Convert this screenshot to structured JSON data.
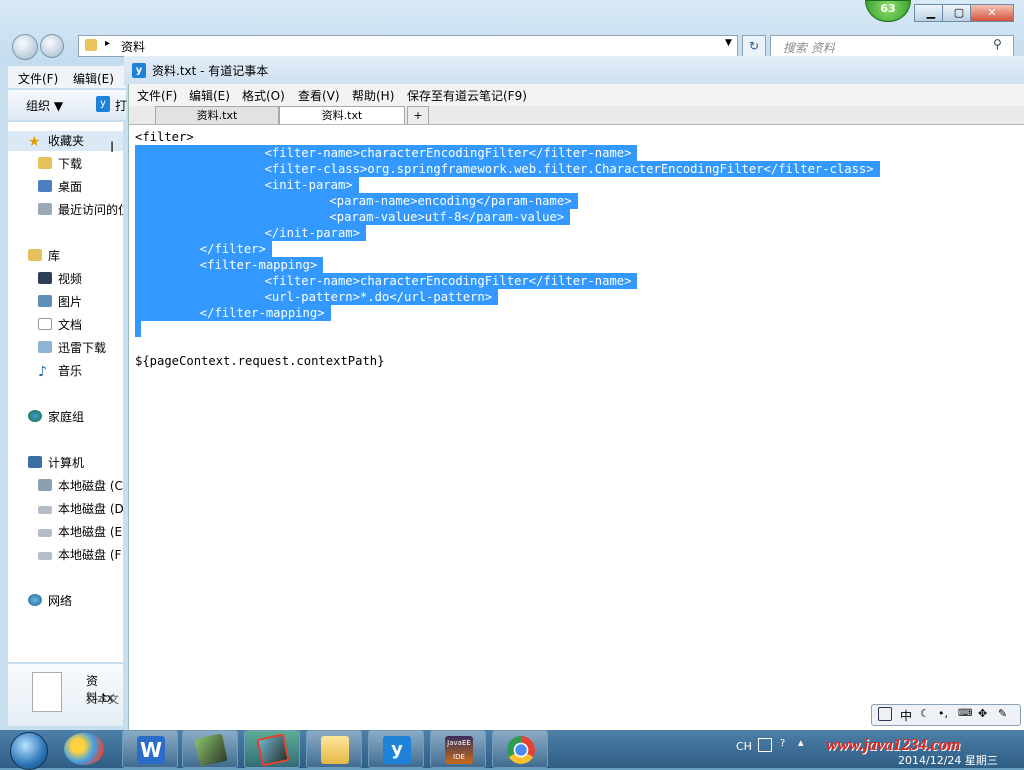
{
  "explorer": {
    "address": "资料",
    "search_placeholder": "搜索 资料",
    "menu": [
      "文件(F)",
      "编辑(E)"
    ],
    "toolbar": {
      "organize": "组织 ▼",
      "open_label": "打"
    },
    "badge": "63",
    "nav": {
      "favorites": "收藏夹",
      "download": "下载",
      "desktop": "桌面",
      "recent": "最近访问的位",
      "libraries": "库",
      "videos": "视频",
      "pictures": "图片",
      "documents": "文档",
      "xunlei": "迅雷下载",
      "music": "音乐",
      "homegroup": "家庭组",
      "computer": "计算机",
      "disk_c": "本地磁盘 (C",
      "disk_d": "本地磁盘 (D",
      "disk_e": "本地磁盘 (E",
      "disk_f": "本地磁盘 (F",
      "network": "网络"
    },
    "details": {
      "filename": "资料.tx",
      "filetype": "文本文"
    }
  },
  "notepad": {
    "title": "资料.txt - 有道记事本",
    "menu": [
      "文件(F)",
      "编辑(E)",
      "格式(O)",
      "查看(V)",
      "帮助(H)",
      "保存至有道云笔记(F9)"
    ],
    "tabs": [
      "资料.txt",
      "资料.txt"
    ],
    "add_tab": "+",
    "lines": [
      {
        "text": "<filter>",
        "indent": 0,
        "selected": false
      },
      {
        "text": "<filter-name>characterEncodingFilter</filter-name>",
        "indent": 2,
        "selected": true
      },
      {
        "text": "<filter-class>org.springframework.web.filter.CharacterEncodingFilter</filter-class>",
        "indent": 2,
        "selected": true
      },
      {
        "text": "<init-param>",
        "indent": 2,
        "selected": true
      },
      {
        "text": "<param-name>encoding</param-name>",
        "indent": 3,
        "selected": true
      },
      {
        "text": "<param-value>utf-8</param-value>",
        "indent": 3,
        "selected": true
      },
      {
        "text": "</init-param>",
        "indent": 2,
        "selected": true
      },
      {
        "text": "</filter>",
        "indent": 1,
        "selected": true
      },
      {
        "text": "<filter-mapping>",
        "indent": 1,
        "selected": true
      },
      {
        "text": "<filter-name>characterEncodingFilter</filter-name>",
        "indent": 2,
        "selected": true
      },
      {
        "text": "<url-pattern>*.do</url-pattern>",
        "indent": 2,
        "selected": true
      },
      {
        "text": "</filter-mapping>",
        "indent": 1,
        "selected": true
      },
      {
        "text": "",
        "indent": 0,
        "selected": true
      },
      {
        "text": "",
        "indent": 0,
        "selected": false
      },
      {
        "text": "${pageContext.request.contextPath}",
        "indent": 0,
        "selected": false
      }
    ]
  },
  "ime": {
    "mode": "中"
  },
  "taskbar": {
    "lang": "CH",
    "watermark": "www.java1234.com",
    "date": "2014/12/24 星期三",
    "apps": [
      "wps-writer-icon",
      "terminal-icon",
      "app-icon",
      "folder-icon",
      "youdao-note-icon",
      "javaee-ide-icon",
      "chrome-icon"
    ]
  }
}
